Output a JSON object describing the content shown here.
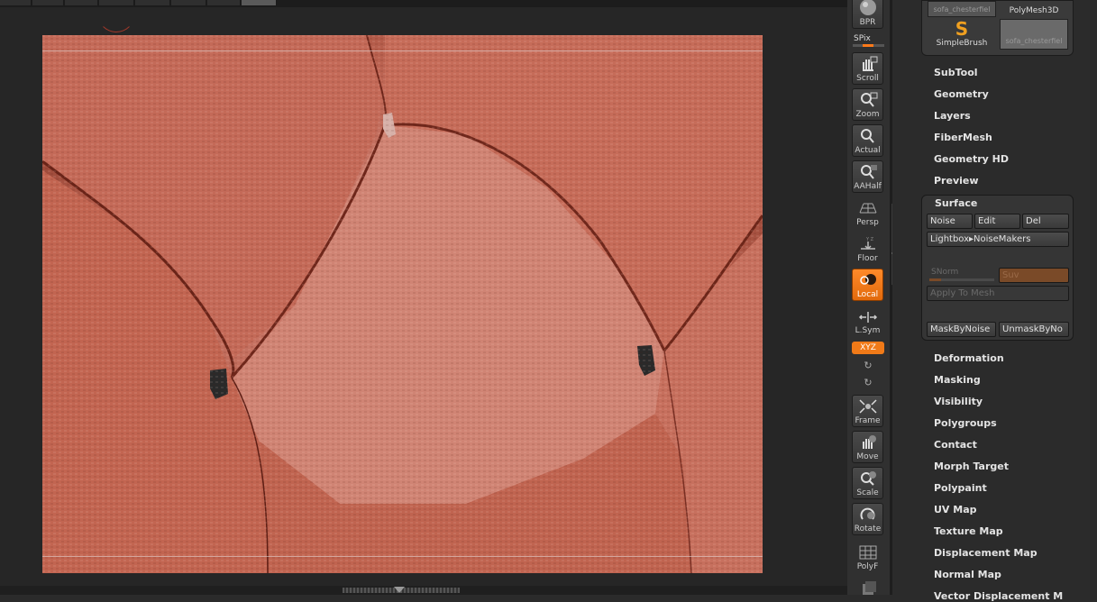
{
  "topbar": {
    "segments": 7
  },
  "shelf": {
    "bpr_label": "BPR",
    "spix_label": "SPix",
    "spix_value": 0.35,
    "tools": [
      {
        "name": "scroll",
        "label": "Scroll",
        "icon": "hand-scroll-icon"
      },
      {
        "name": "zoom",
        "label": "Zoom",
        "icon": "zoom-icon"
      },
      {
        "name": "actual",
        "label": "Actual",
        "icon": "actual-size-icon"
      },
      {
        "name": "aahalf",
        "label": "AAHalf",
        "icon": "aahalf-icon"
      },
      {
        "name": "persp",
        "label": "Persp",
        "icon": "perspective-icon"
      },
      {
        "name": "floor",
        "label": "Floor",
        "icon": "floor-grid-icon"
      },
      {
        "name": "local",
        "label": "Local",
        "icon": "local-icon",
        "active": true
      },
      {
        "name": "lsym",
        "label": "L.Sym",
        "icon": "local-symmetry-icon"
      }
    ],
    "xyz_label": "XYZ",
    "tools2": [
      {
        "name": "frame",
        "label": "Frame",
        "icon": "frame-icon"
      },
      {
        "name": "move",
        "label": "Move",
        "icon": "move-icon"
      },
      {
        "name": "scale",
        "label": "Scale",
        "icon": "scale-icon"
      },
      {
        "name": "rotate",
        "label": "Rotate",
        "icon": "rotate-icon"
      },
      {
        "name": "polyf",
        "label": "PolyF",
        "icon": "polyframe-icon"
      }
    ]
  },
  "thumbnails": {
    "top_left": "sofa_chesterfiel",
    "top_right": "PolyMesh3D",
    "bottom_left": "SimpleBrush",
    "bottom_right": "sofa_chesterfiel"
  },
  "menu_top": [
    "SubTool",
    "Geometry",
    "Layers",
    "FiberMesh",
    "Geometry HD",
    "Preview"
  ],
  "surface": {
    "title": "Surface",
    "noise": "Noise",
    "edit": "Edit",
    "del": "Del",
    "lightbox": "Lightbox▸NoiseMakers",
    "snorm": "SNorm",
    "suv": "Suv",
    "apply": "Apply To Mesh",
    "mask": "MaskByNoise",
    "unmask": "UnmaskByNo"
  },
  "menu_bottom": [
    "Deformation",
    "Masking",
    "Visibility",
    "Polygroups",
    "Contact",
    "Morph Target",
    "Polypaint",
    "UV Map",
    "Texture Map",
    "Displacement Map",
    "Normal Map",
    "Vector Displacement M"
  ],
  "colors": {
    "accent": "#f07a18",
    "clay": "#b8604f"
  }
}
